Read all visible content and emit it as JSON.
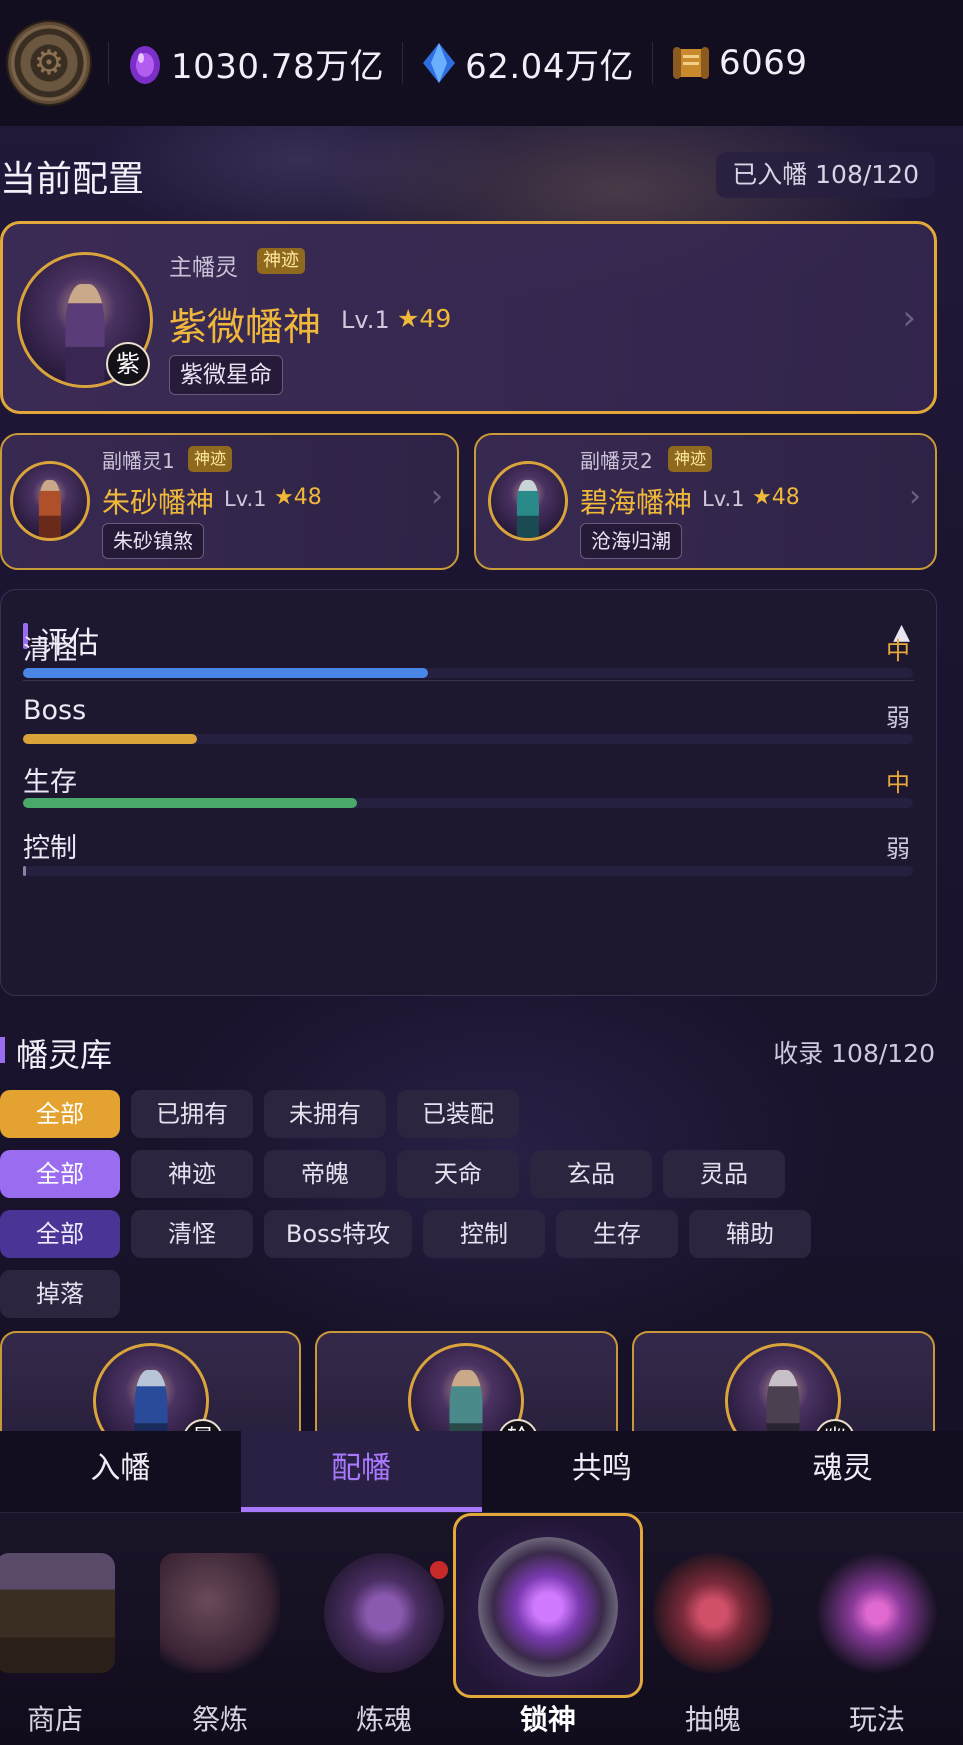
{
  "resources": [
    {
      "icon": "purple-egg-icon",
      "value": "1030.78万亿"
    },
    {
      "icon": "blue-crystal-icon",
      "value": "62.04万亿"
    },
    {
      "icon": "scroll-icon",
      "value": "6069"
    }
  ],
  "current_config": {
    "title": "当前配置",
    "count": "已入幡 108/120",
    "main": {
      "role": "主幡灵",
      "tag": "神迹",
      "name": "紫微幡神",
      "level": "Lv.1",
      "stars": "★49",
      "skill": "紫微星命",
      "char": "紫"
    },
    "subs": [
      {
        "role": "副幡灵1",
        "tag": "神迹",
        "name": "朱砂幡神",
        "level": "Lv.1",
        "stars": "★48",
        "skill": "朱砂镇煞"
      },
      {
        "role": "副幡灵2",
        "tag": "神迹",
        "name": "碧海幡神",
        "level": "Lv.1",
        "stars": "★48",
        "skill": "沧海归潮"
      }
    ]
  },
  "evaluation": {
    "title": "评估",
    "toggle": "▲",
    "metrics": [
      {
        "name": "清怪",
        "level": "中",
        "value": 0.455,
        "color": "#4a86e8",
        "level_color": "#e8a83a"
      },
      {
        "name": "Boss",
        "level": "弱",
        "value": 0.195,
        "color": "#d9a33a",
        "level_color": "#cfc8dc"
      },
      {
        "name": "生存",
        "level": "中",
        "value": 0.375,
        "color": "#4aa86a",
        "level_color": "#e8a83a"
      },
      {
        "name": "控制",
        "level": "弱",
        "value": 0.0,
        "color": "#8a84a0",
        "level_color": "#cfc8dc"
      }
    ]
  },
  "library": {
    "title": "幡灵库",
    "count": "收录 108/120",
    "filter_rows": [
      [
        "全部",
        "已拥有",
        "未拥有",
        "已装配"
      ],
      [
        "全部",
        "神迹",
        "帝魄",
        "天命",
        "玄品",
        "灵品"
      ],
      [
        "全部",
        "清怪",
        "Boss特攻",
        "控制",
        "生存",
        "辅助"
      ],
      [
        "掉落"
      ]
    ],
    "cards": [
      {
        "char": "星"
      },
      {
        "char": "轮"
      },
      {
        "char": "幽"
      }
    ]
  },
  "sub_tabs": [
    "入幡",
    "配幡",
    "共鸣",
    "魂灵"
  ],
  "active_sub_tab": "配幡",
  "bottom_nav": [
    "商店",
    "祭炼",
    "炼魂",
    "锁神",
    "抽魄",
    "玩法"
  ],
  "active_nav": "锁神"
}
